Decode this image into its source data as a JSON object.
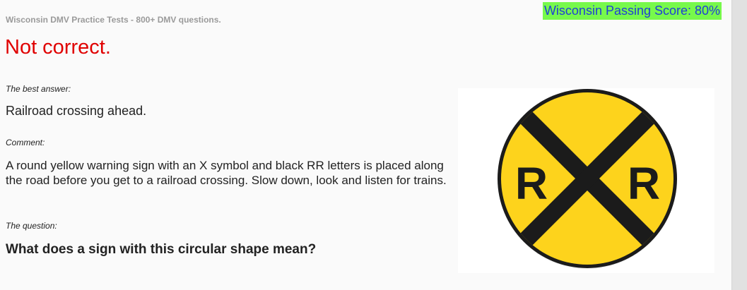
{
  "header": {
    "site_title": "Wisconsin DMV Practice Tests - 800+ DMV questions.",
    "passing_score": "Wisconsin Passing Score: 80%"
  },
  "result": {
    "status_text": "Not correct.",
    "status_color": "#e00000"
  },
  "answer_section": {
    "best_answer_label": "The best answer:",
    "best_answer": "Railroad crossing ahead.",
    "comment_label": "Comment:",
    "comment": "A round yellow warning sign with an X symbol and black RR letters is placed along the road before you get to a railroad crossing. Slow down, look and listen for trains.",
    "question_label": "The question:",
    "question": "What does a sign with this circular shape mean?"
  },
  "sign": {
    "icon": "railroad-crossing-sign-icon",
    "letter_left": "R",
    "letter_right": "R",
    "fill_color": "#fdd31c",
    "ink_color": "#1b1b1b"
  },
  "colors": {
    "passing_score_bg": "#77f94b",
    "passing_score_text": "#1f3fd6"
  }
}
